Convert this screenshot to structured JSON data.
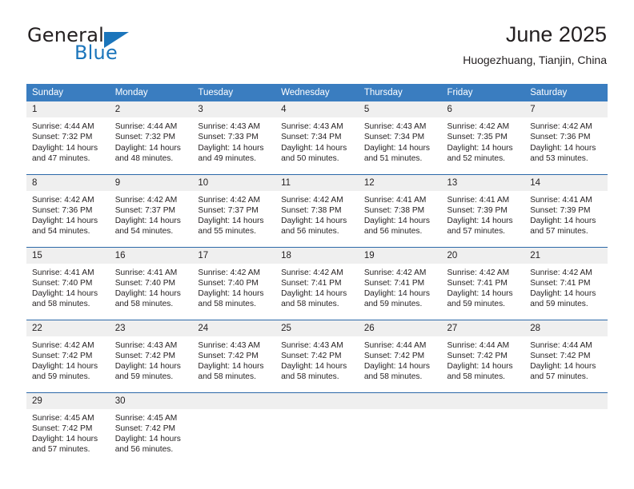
{
  "brand": {
    "name_part1": "General",
    "name_part2": "Blue",
    "accent_color": "#1b75bb"
  },
  "header": {
    "title": "June 2025",
    "subtitle": "Huogezhuang, Tianjin, China"
  },
  "calendar": {
    "header_bg": "#3a7dc0",
    "daynum_bg": "#efefef",
    "rule_color": "#2c68a8",
    "weekdays": [
      "Sunday",
      "Monday",
      "Tuesday",
      "Wednesday",
      "Thursday",
      "Friday",
      "Saturday"
    ],
    "weeks": [
      [
        {
          "day": "1",
          "sunrise": "Sunrise: 4:44 AM",
          "sunset": "Sunset: 7:32 PM",
          "daylight1": "Daylight: 14 hours",
          "daylight2": "and 47 minutes."
        },
        {
          "day": "2",
          "sunrise": "Sunrise: 4:44 AM",
          "sunset": "Sunset: 7:32 PM",
          "daylight1": "Daylight: 14 hours",
          "daylight2": "and 48 minutes."
        },
        {
          "day": "3",
          "sunrise": "Sunrise: 4:43 AM",
          "sunset": "Sunset: 7:33 PM",
          "daylight1": "Daylight: 14 hours",
          "daylight2": "and 49 minutes."
        },
        {
          "day": "4",
          "sunrise": "Sunrise: 4:43 AM",
          "sunset": "Sunset: 7:34 PM",
          "daylight1": "Daylight: 14 hours",
          "daylight2": "and 50 minutes."
        },
        {
          "day": "5",
          "sunrise": "Sunrise: 4:43 AM",
          "sunset": "Sunset: 7:34 PM",
          "daylight1": "Daylight: 14 hours",
          "daylight2": "and 51 minutes."
        },
        {
          "day": "6",
          "sunrise": "Sunrise: 4:42 AM",
          "sunset": "Sunset: 7:35 PM",
          "daylight1": "Daylight: 14 hours",
          "daylight2": "and 52 minutes."
        },
        {
          "day": "7",
          "sunrise": "Sunrise: 4:42 AM",
          "sunset": "Sunset: 7:36 PM",
          "daylight1": "Daylight: 14 hours",
          "daylight2": "and 53 minutes."
        }
      ],
      [
        {
          "day": "8",
          "sunrise": "Sunrise: 4:42 AM",
          "sunset": "Sunset: 7:36 PM",
          "daylight1": "Daylight: 14 hours",
          "daylight2": "and 54 minutes."
        },
        {
          "day": "9",
          "sunrise": "Sunrise: 4:42 AM",
          "sunset": "Sunset: 7:37 PM",
          "daylight1": "Daylight: 14 hours",
          "daylight2": "and 54 minutes."
        },
        {
          "day": "10",
          "sunrise": "Sunrise: 4:42 AM",
          "sunset": "Sunset: 7:37 PM",
          "daylight1": "Daylight: 14 hours",
          "daylight2": "and 55 minutes."
        },
        {
          "day": "11",
          "sunrise": "Sunrise: 4:42 AM",
          "sunset": "Sunset: 7:38 PM",
          "daylight1": "Daylight: 14 hours",
          "daylight2": "and 56 minutes."
        },
        {
          "day": "12",
          "sunrise": "Sunrise: 4:41 AM",
          "sunset": "Sunset: 7:38 PM",
          "daylight1": "Daylight: 14 hours",
          "daylight2": "and 56 minutes."
        },
        {
          "day": "13",
          "sunrise": "Sunrise: 4:41 AM",
          "sunset": "Sunset: 7:39 PM",
          "daylight1": "Daylight: 14 hours",
          "daylight2": "and 57 minutes."
        },
        {
          "day": "14",
          "sunrise": "Sunrise: 4:41 AM",
          "sunset": "Sunset: 7:39 PM",
          "daylight1": "Daylight: 14 hours",
          "daylight2": "and 57 minutes."
        }
      ],
      [
        {
          "day": "15",
          "sunrise": "Sunrise: 4:41 AM",
          "sunset": "Sunset: 7:40 PM",
          "daylight1": "Daylight: 14 hours",
          "daylight2": "and 58 minutes."
        },
        {
          "day": "16",
          "sunrise": "Sunrise: 4:41 AM",
          "sunset": "Sunset: 7:40 PM",
          "daylight1": "Daylight: 14 hours",
          "daylight2": "and 58 minutes."
        },
        {
          "day": "17",
          "sunrise": "Sunrise: 4:42 AM",
          "sunset": "Sunset: 7:40 PM",
          "daylight1": "Daylight: 14 hours",
          "daylight2": "and 58 minutes."
        },
        {
          "day": "18",
          "sunrise": "Sunrise: 4:42 AM",
          "sunset": "Sunset: 7:41 PM",
          "daylight1": "Daylight: 14 hours",
          "daylight2": "and 58 minutes."
        },
        {
          "day": "19",
          "sunrise": "Sunrise: 4:42 AM",
          "sunset": "Sunset: 7:41 PM",
          "daylight1": "Daylight: 14 hours",
          "daylight2": "and 59 minutes."
        },
        {
          "day": "20",
          "sunrise": "Sunrise: 4:42 AM",
          "sunset": "Sunset: 7:41 PM",
          "daylight1": "Daylight: 14 hours",
          "daylight2": "and 59 minutes."
        },
        {
          "day": "21",
          "sunrise": "Sunrise: 4:42 AM",
          "sunset": "Sunset: 7:41 PM",
          "daylight1": "Daylight: 14 hours",
          "daylight2": "and 59 minutes."
        }
      ],
      [
        {
          "day": "22",
          "sunrise": "Sunrise: 4:42 AM",
          "sunset": "Sunset: 7:42 PM",
          "daylight1": "Daylight: 14 hours",
          "daylight2": "and 59 minutes."
        },
        {
          "day": "23",
          "sunrise": "Sunrise: 4:43 AM",
          "sunset": "Sunset: 7:42 PM",
          "daylight1": "Daylight: 14 hours",
          "daylight2": "and 59 minutes."
        },
        {
          "day": "24",
          "sunrise": "Sunrise: 4:43 AM",
          "sunset": "Sunset: 7:42 PM",
          "daylight1": "Daylight: 14 hours",
          "daylight2": "and 58 minutes."
        },
        {
          "day": "25",
          "sunrise": "Sunrise: 4:43 AM",
          "sunset": "Sunset: 7:42 PM",
          "daylight1": "Daylight: 14 hours",
          "daylight2": "and 58 minutes."
        },
        {
          "day": "26",
          "sunrise": "Sunrise: 4:44 AM",
          "sunset": "Sunset: 7:42 PM",
          "daylight1": "Daylight: 14 hours",
          "daylight2": "and 58 minutes."
        },
        {
          "day": "27",
          "sunrise": "Sunrise: 4:44 AM",
          "sunset": "Sunset: 7:42 PM",
          "daylight1": "Daylight: 14 hours",
          "daylight2": "and 58 minutes."
        },
        {
          "day": "28",
          "sunrise": "Sunrise: 4:44 AM",
          "sunset": "Sunset: 7:42 PM",
          "daylight1": "Daylight: 14 hours",
          "daylight2": "and 57 minutes."
        }
      ],
      [
        {
          "day": "29",
          "sunrise": "Sunrise: 4:45 AM",
          "sunset": "Sunset: 7:42 PM",
          "daylight1": "Daylight: 14 hours",
          "daylight2": "and 57 minutes."
        },
        {
          "day": "30",
          "sunrise": "Sunrise: 4:45 AM",
          "sunset": "Sunset: 7:42 PM",
          "daylight1": "Daylight: 14 hours",
          "daylight2": "and 56 minutes."
        },
        {
          "day": "",
          "sunrise": "",
          "sunset": "",
          "daylight1": "",
          "daylight2": ""
        },
        {
          "day": "",
          "sunrise": "",
          "sunset": "",
          "daylight1": "",
          "daylight2": ""
        },
        {
          "day": "",
          "sunrise": "",
          "sunset": "",
          "daylight1": "",
          "daylight2": ""
        },
        {
          "day": "",
          "sunrise": "",
          "sunset": "",
          "daylight1": "",
          "daylight2": ""
        },
        {
          "day": "",
          "sunrise": "",
          "sunset": "",
          "daylight1": "",
          "daylight2": ""
        }
      ]
    ]
  }
}
